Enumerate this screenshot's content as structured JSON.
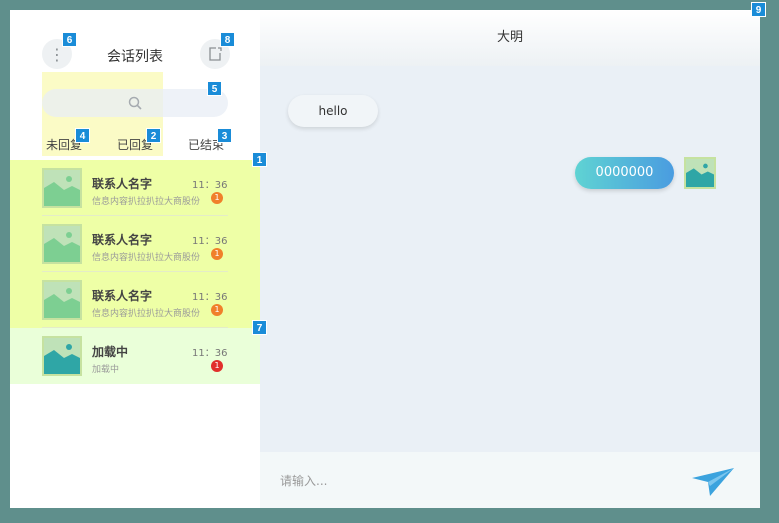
{
  "sidebar": {
    "title": "会话列表",
    "search_icon": "search-icon",
    "tabs": [
      {
        "label": "未回复"
      },
      {
        "label": "已回复"
      },
      {
        "label": "已结束"
      }
    ],
    "contacts": [
      {
        "name": "联系人名字",
        "preview": "信息内容扒拉扒拉大商股份",
        "time": "11：36",
        "badge": "1"
      },
      {
        "name": "联系人名字",
        "preview": "信息内容扒拉扒拉大商股份",
        "time": "11：36",
        "badge": "1"
      },
      {
        "name": "联系人名字",
        "preview": "信息内容扒拉扒拉大商股份",
        "time": "11：36",
        "badge": "1"
      },
      {
        "name": "加载中",
        "preview": "加载中",
        "time": "11：36",
        "badge": "1"
      }
    ]
  },
  "chat": {
    "title": "大明",
    "messages": [
      {
        "direction": "in",
        "text": "hello"
      },
      {
        "direction": "out",
        "text": "0000000"
      }
    ],
    "input_placeholder": "请输入..."
  },
  "markers": [
    "1",
    "2",
    "3",
    "4",
    "5",
    "6",
    "7",
    "8",
    "9"
  ],
  "colors": {
    "background": "#5f8f8c",
    "highlight_yellow": "#eeffa6",
    "highlight_green": "#eaffd9",
    "accent_blue": "#1a8cd8",
    "send_blue": "#3ba3de"
  }
}
